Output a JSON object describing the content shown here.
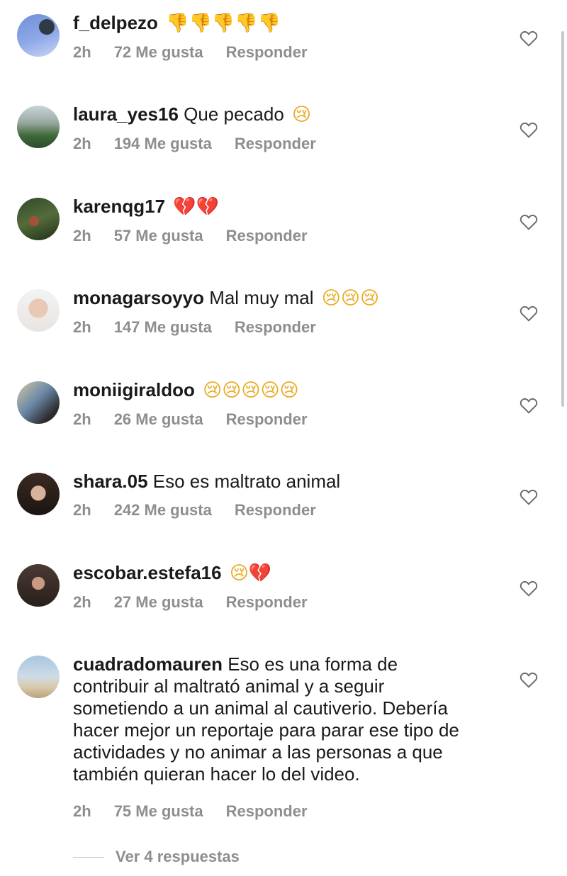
{
  "comments": [
    {
      "username": "f_delpezo",
      "text": "",
      "emoji": "👎👎👎👎👎",
      "time": "2h",
      "likes": "72 Me gusta",
      "reply": "Responder"
    },
    {
      "username": "laura_yes16",
      "text": "Que pecado",
      "emoji": "😢",
      "time": "2h",
      "likes": "194 Me gusta",
      "reply": "Responder"
    },
    {
      "username": "karenqg17",
      "text": "",
      "emoji": "💔💔",
      "time": "2h",
      "likes": "57 Me gusta",
      "reply": "Responder"
    },
    {
      "username": "monagarsoyyo",
      "text": "Mal muy mal",
      "emoji": "😢😢😢",
      "time": "2h",
      "likes": "147 Me gusta",
      "reply": "Responder"
    },
    {
      "username": "moniigiraldoo",
      "text": "",
      "emoji": "😢😢😢😢😢",
      "time": "2h",
      "likes": "26 Me gusta",
      "reply": "Responder"
    },
    {
      "username": "shara.05",
      "text": "Eso es maltrato animal",
      "emoji": "",
      "time": "2h",
      "likes": "242 Me gusta",
      "reply": "Responder"
    },
    {
      "username": "escobar.estefa16",
      "text": "",
      "emoji": "😢💔",
      "time": "2h",
      "likes": "27 Me gusta",
      "reply": "Responder"
    },
    {
      "username": "cuadradomauren",
      "text_lines": [
        "Eso es una forma de",
        "contribuir al maltrató animal y a seguir",
        "sometiendo a un animal al cautiverio. Debería",
        "hacer mejor un reportaje para parar ese tipo de",
        "actividades y no animar  a las personas a que",
        "también quieran hacer lo del video."
      ],
      "time": "2h",
      "likes": "75 Me gusta",
      "reply": "Responder"
    }
  ],
  "view_replies": "Ver 4 respuestas",
  "icons": {
    "like": "heart-outline-icon"
  },
  "colors": {
    "text": "#1a1a1a",
    "meta": "#8e8e8e"
  }
}
